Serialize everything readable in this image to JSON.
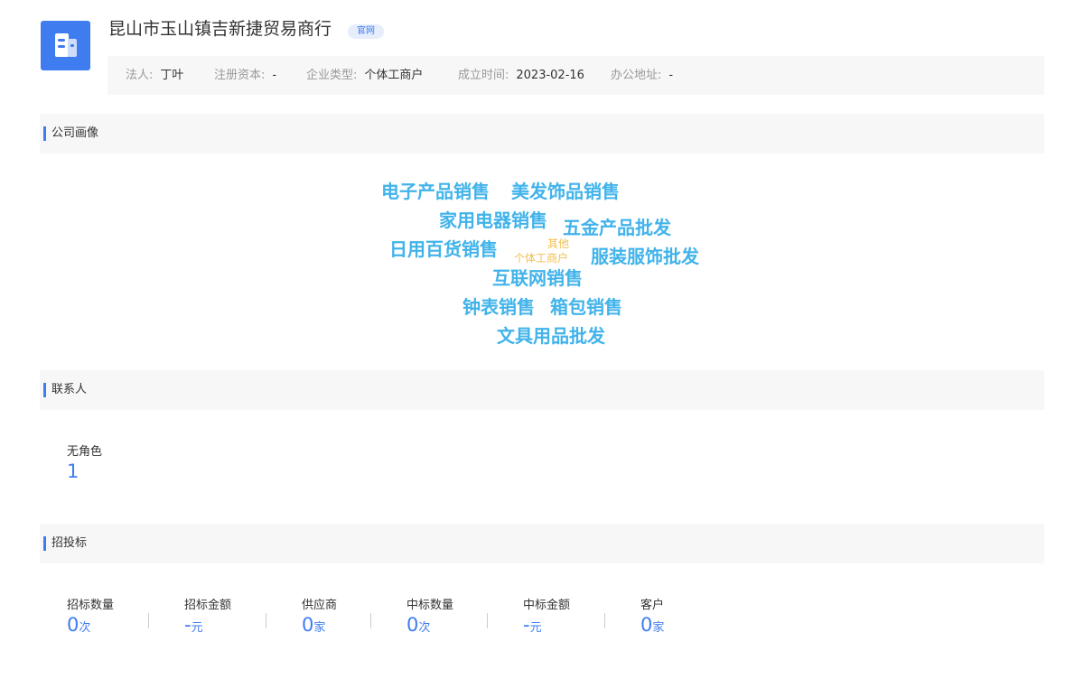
{
  "company": {
    "name": "昆山市玉山镇吉新捷贸易商行",
    "website_badge": "官网",
    "info": [
      {
        "label": "法人:",
        "value": "丁叶"
      },
      {
        "label": "注册资本:",
        "value": "-"
      },
      {
        "label": "企业类型:",
        "value": "个体工商户"
      },
      {
        "label": "成立时间:",
        "value": "2023-02-16"
      },
      {
        "label": "办公地址:",
        "value": "-"
      }
    ]
  },
  "sections": {
    "portrait": "公司画像",
    "contacts": "联系人",
    "bidding": "招投标"
  },
  "word_cloud": {
    "colors": {
      "primary": "#41b3ea",
      "secondary": "#f2c04d"
    },
    "words": [
      "电子产品销售",
      "美发饰品销售",
      "家用电器销售",
      "五金产品批发",
      "日用百货销售",
      "其他",
      "个体工商户",
      "服装服饰批发",
      "互联网销售",
      "钟表销售",
      "箱包销售",
      "文具用品批发"
    ]
  },
  "contacts": {
    "role_label": "无角色",
    "role_count": "1"
  },
  "bidding": {
    "stats": [
      {
        "label": "招标数量",
        "value": "0",
        "unit": "次"
      },
      {
        "label": "招标金额",
        "value": "-",
        "unit": "元"
      },
      {
        "label": "供应商",
        "value": "0",
        "unit": "家"
      },
      {
        "label": "中标数量",
        "value": "0",
        "unit": "次"
      },
      {
        "label": "中标金额",
        "value": "-",
        "unit": "元"
      },
      {
        "label": "客户",
        "value": "0",
        "unit": "家"
      }
    ]
  },
  "accent_color": "#3f7cf0"
}
